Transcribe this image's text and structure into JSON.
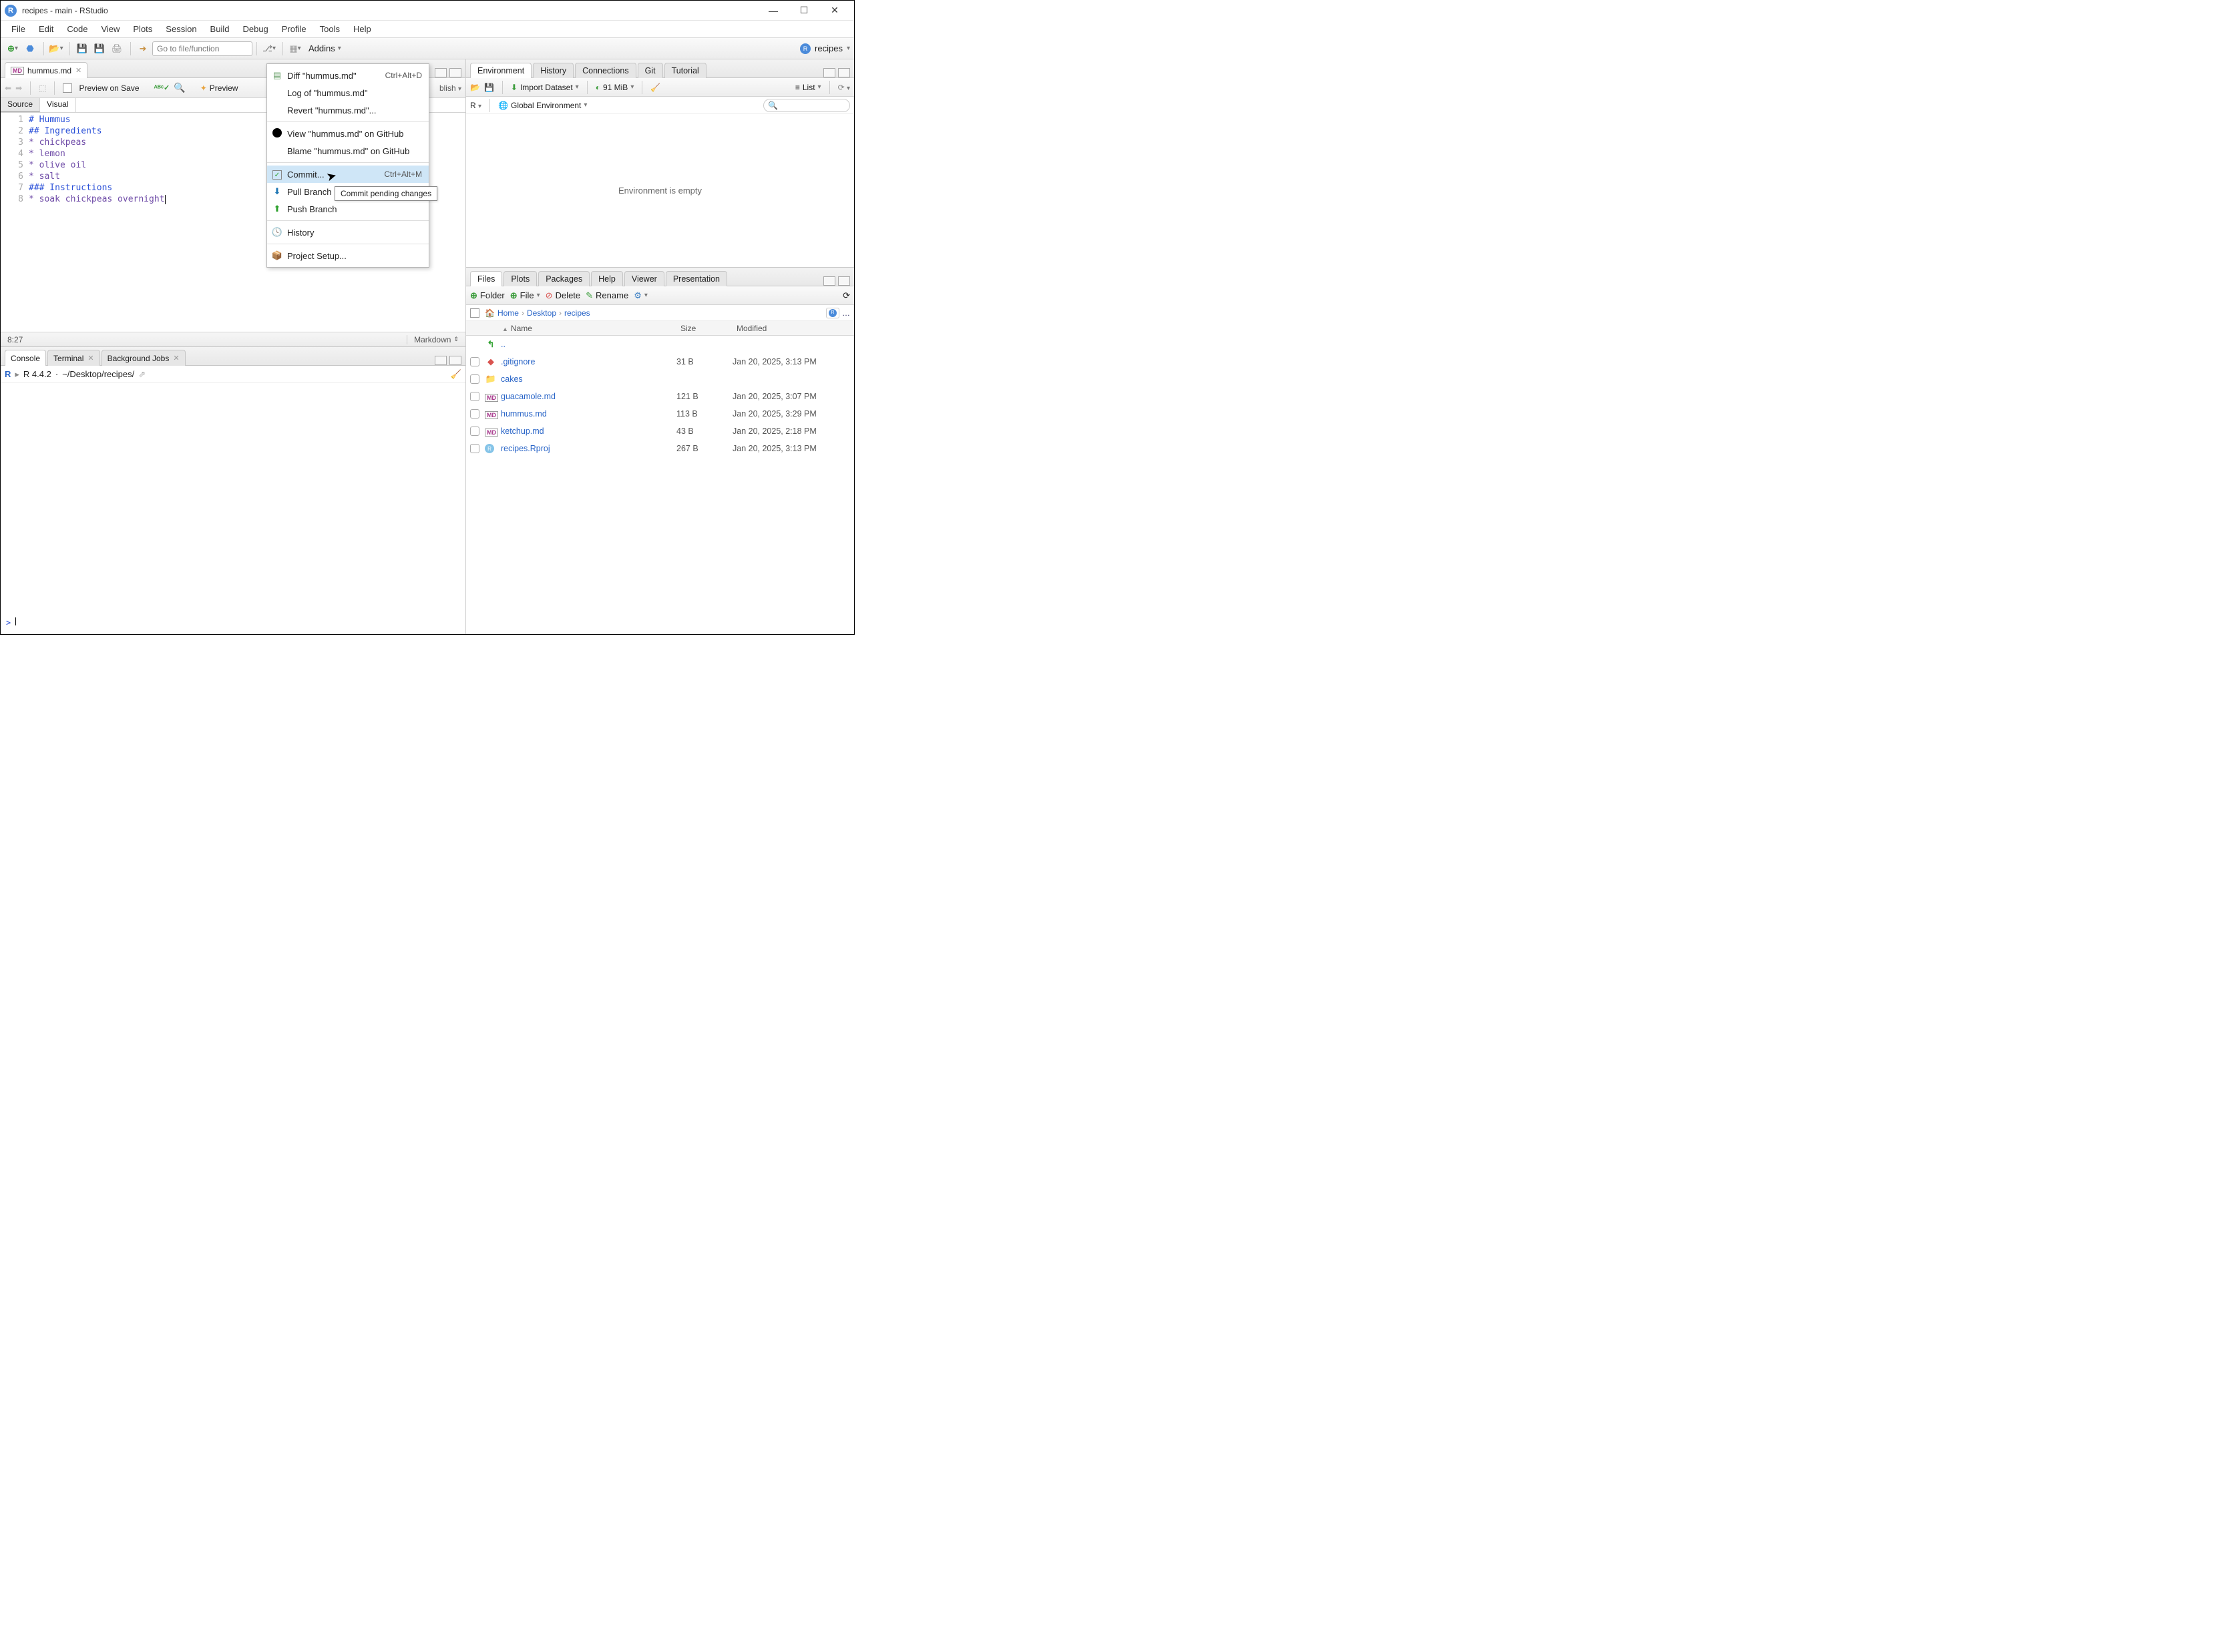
{
  "window": {
    "title": "recipes - main - RStudio"
  },
  "menubar": [
    "File",
    "Edit",
    "Code",
    "View",
    "Plots",
    "Session",
    "Build",
    "Debug",
    "Profile",
    "Tools",
    "Help"
  ],
  "toolbar": {
    "goto_placeholder": "Go to file/function",
    "addins_label": "Addins",
    "project_label": "recipes"
  },
  "editor_tab": {
    "filename": "hummus.md"
  },
  "source_toolbar": {
    "preview_on_save": "Preview on Save",
    "preview": "Preview",
    "publish": "blish",
    "source_tab": "Source",
    "visual_tab": "Visual"
  },
  "editor_lines": [
    {
      "n": "1",
      "cls": "h1",
      "text": "# Hummus"
    },
    {
      "n": "2",
      "cls": "h2",
      "text": "## Ingredients"
    },
    {
      "n": "3",
      "cls": "li",
      "text": " * chickpeas"
    },
    {
      "n": "4",
      "cls": "li",
      "text": " * lemon"
    },
    {
      "n": "5",
      "cls": "li",
      "text": " * olive oil"
    },
    {
      "n": "6",
      "cls": "li",
      "text": " * salt"
    },
    {
      "n": "7",
      "cls": "h3",
      "text": "### Instructions"
    },
    {
      "n": "8",
      "cls": "li",
      "text": " * soak chickpeas overnight"
    }
  ],
  "statusbar": {
    "pos": "8:27",
    "lang": "Markdown"
  },
  "console_tabs": {
    "console": "Console",
    "terminal": "Terminal",
    "bg": "Background Jobs"
  },
  "console": {
    "version": "R 4.4.2",
    "path": "~/Desktop/recipes/",
    "prompt": ">"
  },
  "env_tabs": [
    "Environment",
    "History",
    "Connections",
    "Git",
    "Tutorial"
  ],
  "env_toolbar": {
    "import": "Import Dataset",
    "mem": "91 MiB",
    "list": "List"
  },
  "env_subtb": {
    "r": "R",
    "global": "Global Environment"
  },
  "env_empty": "Environment is empty",
  "files_tabs": [
    "Files",
    "Plots",
    "Packages",
    "Help",
    "Viewer",
    "Presentation"
  ],
  "files_toolbar": {
    "folder": "Folder",
    "file": "File",
    "delete": "Delete",
    "rename": "Rename"
  },
  "breadcrumb": [
    "Home",
    "Desktop",
    "recipes"
  ],
  "file_cols": {
    "name": "Name",
    "size": "Size",
    "mod": "Modified"
  },
  "files": [
    {
      "icon": "up",
      "name": "..",
      "size": "",
      "mod": "",
      "color": "#2ca02c"
    },
    {
      "icon": "git",
      "name": ".gitignore",
      "size": "31 B",
      "mod": "Jan 20, 2025, 3:13 PM"
    },
    {
      "icon": "folder",
      "name": "cakes",
      "size": "",
      "mod": ""
    },
    {
      "icon": "md",
      "name": "guacamole.md",
      "size": "121 B",
      "mod": "Jan 20, 2025, 3:07 PM"
    },
    {
      "icon": "md",
      "name": "hummus.md",
      "size": "113 B",
      "mod": "Jan 20, 2025, 3:29 PM"
    },
    {
      "icon": "md",
      "name": "ketchup.md",
      "size": "43 B",
      "mod": "Jan 20, 2025, 2:18 PM"
    },
    {
      "icon": "rproj",
      "name": "recipes.Rproj",
      "size": "267 B",
      "mod": "Jan 20, 2025, 3:13 PM"
    }
  ],
  "context_menu": {
    "items": [
      {
        "icon": "diff",
        "label": "Diff \"hummus.md\"",
        "shortcut": "Ctrl+Alt+D"
      },
      {
        "icon": "",
        "label": "Log of \"hummus.md\"",
        "shortcut": ""
      },
      {
        "icon": "",
        "label": "Revert \"hummus.md\"...",
        "shortcut": ""
      },
      {
        "sep": true
      },
      {
        "icon": "gh",
        "label": "View \"hummus.md\" on GitHub",
        "shortcut": ""
      },
      {
        "icon": "",
        "label": "Blame \"hummus.md\" on GitHub",
        "shortcut": ""
      },
      {
        "sep": true
      },
      {
        "icon": "check",
        "label": "Commit...",
        "shortcut": "Ctrl+Alt+M",
        "hl": true
      },
      {
        "icon": "pull",
        "label": "Pull Branch",
        "shortcut": ""
      },
      {
        "icon": "push",
        "label": "Push Branch",
        "shortcut": ""
      },
      {
        "sep": true
      },
      {
        "icon": "clock",
        "label": "History",
        "shortcut": ""
      },
      {
        "sep": true
      },
      {
        "icon": "box",
        "label": "Project Setup...",
        "shortcut": ""
      }
    ]
  },
  "tooltip": "Commit pending changes"
}
